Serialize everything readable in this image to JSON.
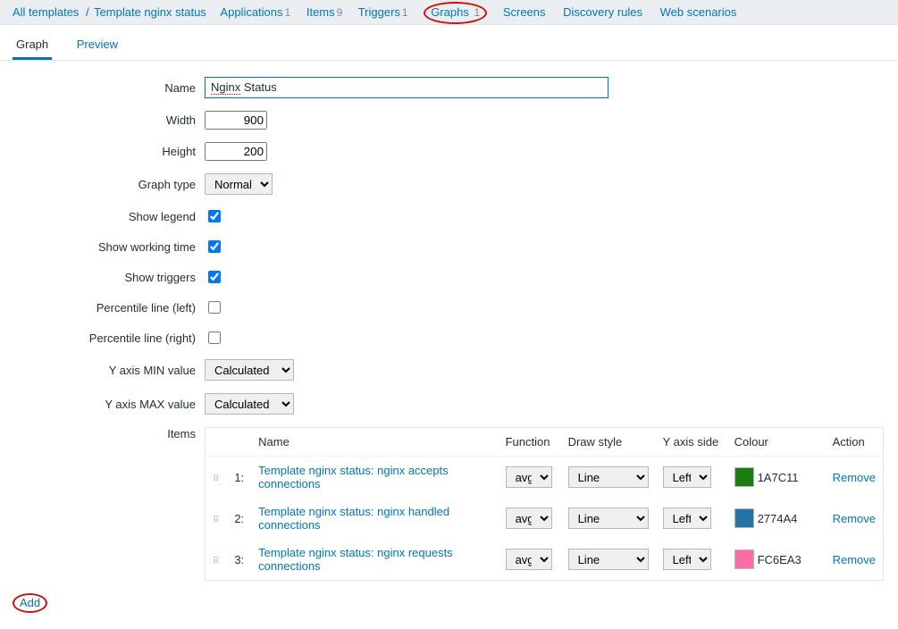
{
  "breadcrumb": {
    "all_templates": "All templates",
    "template": "Template nginx status",
    "items": [
      {
        "label": "Applications",
        "count": "1"
      },
      {
        "label": "Items",
        "count": "9"
      },
      {
        "label": "Triggers",
        "count": "1"
      },
      {
        "label": "Graphs",
        "count": "1"
      },
      {
        "label": "Screens",
        "count": ""
      },
      {
        "label": "Discovery rules",
        "count": ""
      },
      {
        "label": "Web scenarios",
        "count": ""
      }
    ]
  },
  "tabs": {
    "graph": "Graph",
    "preview": "Preview"
  },
  "labels": {
    "name": "Name",
    "width": "Width",
    "height": "Height",
    "graph_type": "Graph type",
    "show_legend": "Show legend",
    "show_working_time": "Show working time",
    "show_triggers": "Show triggers",
    "perc_left": "Percentile line (left)",
    "perc_right": "Percentile line (right)",
    "ymin": "Y axis MIN value",
    "ymax": "Y axis MAX value",
    "items": "Items"
  },
  "values": {
    "name_pre": "Nginx",
    "name_post": " Status",
    "width": "900",
    "height": "200",
    "graph_type": "Normal",
    "show_legend": true,
    "show_working_time": true,
    "show_triggers": true,
    "perc_left": false,
    "perc_right": false,
    "ymin": "Calculated",
    "ymax": "Calculated"
  },
  "items_headers": {
    "name": "Name",
    "function": "Function",
    "draw": "Draw style",
    "yaxis": "Y axis side",
    "color": "Colour",
    "action": "Action"
  },
  "items": [
    {
      "idx": "1:",
      "name": "Template nginx status: nginx accepts connections",
      "func": "avg",
      "draw": "Line",
      "side": "Left",
      "color": "#1A7C11",
      "code": "1A7C11",
      "action": "Remove"
    },
    {
      "idx": "2:",
      "name": "Template nginx status: nginx handled connections",
      "func": "avg",
      "draw": "Line",
      "side": "Left",
      "color": "#2774A4",
      "code": "2774A4",
      "action": "Remove"
    },
    {
      "idx": "3:",
      "name": "Template nginx status: nginx requests connections",
      "func": "avg",
      "draw": "Line",
      "side": "Left",
      "color": "#FC6EA3",
      "code": "FC6EA3",
      "action": "Remove"
    }
  ],
  "add_label": "Add"
}
